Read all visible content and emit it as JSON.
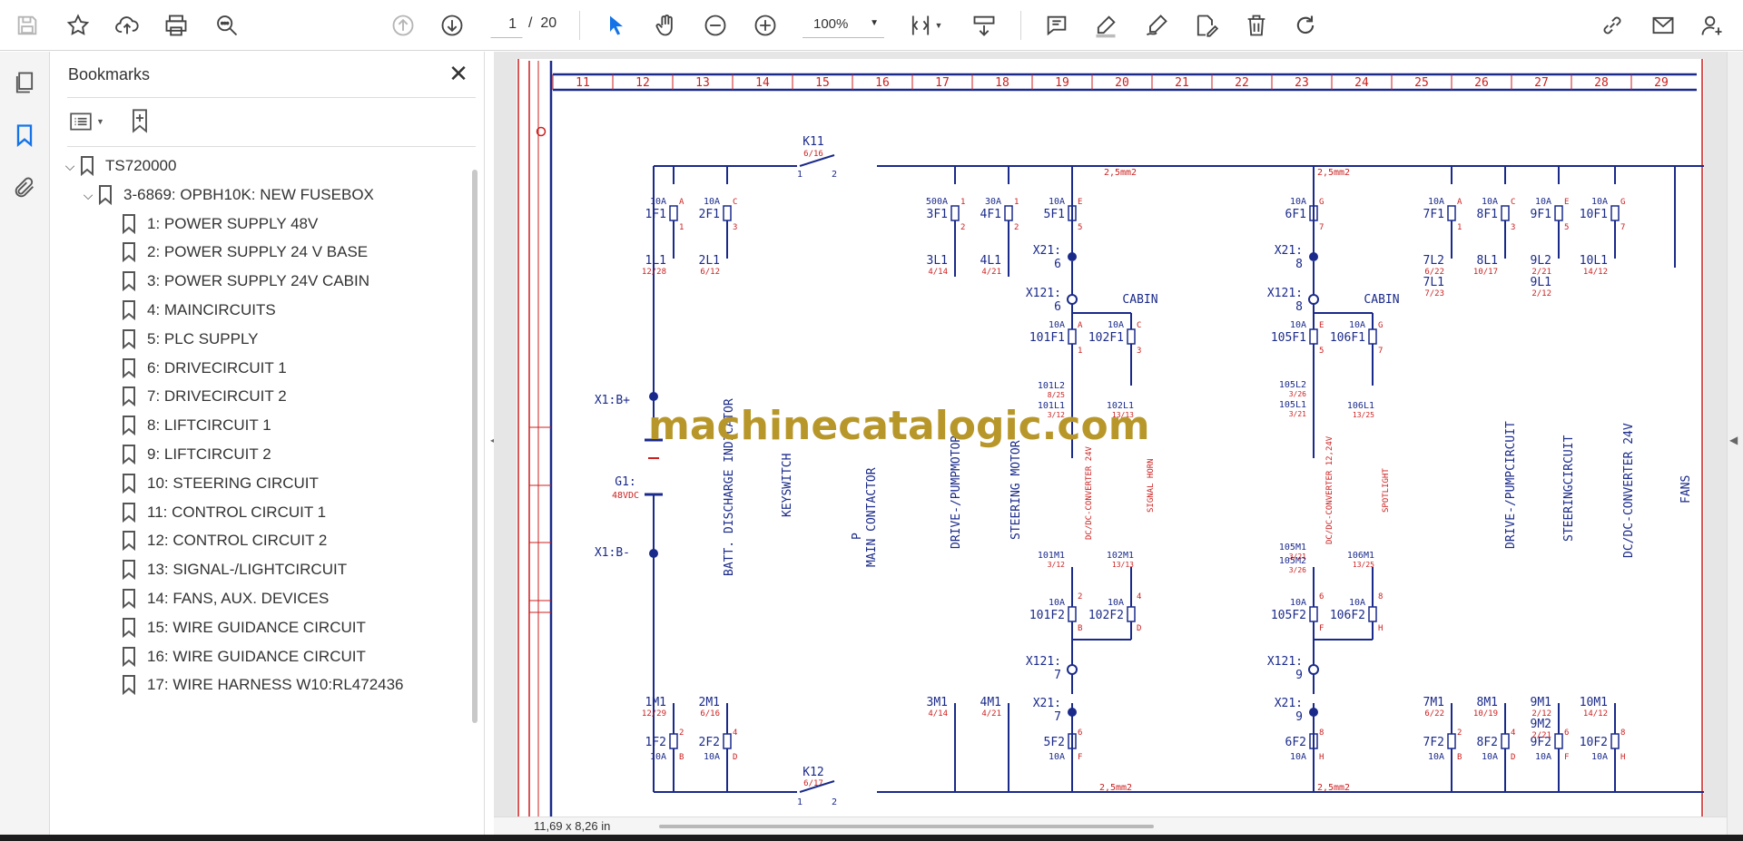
{
  "toolbar": {
    "page_current": "1",
    "page_separator": "/",
    "page_total": "20",
    "zoom": "100%"
  },
  "bookmarks_panel": {
    "title": "Bookmarks",
    "items": [
      {
        "label": "TS720000"
      },
      {
        "label": "3-6869: OPBH10K: NEW FUSEBOX"
      },
      {
        "label": "1: POWER SUPPLY 48V"
      },
      {
        "label": "2: POWER SUPPLY 24 V BASE"
      },
      {
        "label": "3: POWER SUPPLY 24V CABIN"
      },
      {
        "label": "4: MAINCIRCUITS"
      },
      {
        "label": "5: PLC SUPPLY"
      },
      {
        "label": "6: DRIVECIRCUIT 1"
      },
      {
        "label": "7: DRIVECIRCUIT 2"
      },
      {
        "label": "8: LIFTCIRCUIT 1"
      },
      {
        "label": "9: LIFTCIRCUIT 2"
      },
      {
        "label": "10: STEERING CIRCUIT"
      },
      {
        "label": "11: CONTROL CIRCUIT 1"
      },
      {
        "label": "12: CONTROL CIRCUIT 2"
      },
      {
        "label": "13: SIGNAL-/LIGHTCIRCUIT"
      },
      {
        "label": "14: FANS, AUX. DEVICES"
      },
      {
        "label": "15: WIRE GUIDANCE CIRCUIT"
      },
      {
        "label": "16: WIRE GUIDANCE CIRCUIT"
      },
      {
        "label": "17: WIRE HARNESS W10:RL472436"
      }
    ]
  },
  "status": {
    "page_size": "11,69 x 8,26 in"
  },
  "watermark": "machinecatalogic.com",
  "schematic": {
    "columns": [
      "11",
      "12",
      "13",
      "14",
      "15",
      "16",
      "17",
      "18",
      "19",
      "20",
      "21",
      "22",
      "23",
      "24",
      "25",
      "26",
      "27",
      "28",
      "29"
    ],
    "switch_k11": {
      "name": "K11",
      "ref": "6/16",
      "pin1": "1",
      "pin2": "2"
    },
    "switch_k12": {
      "name": "K12",
      "ref": "6/17",
      "pin1": "1",
      "pin2": "2"
    },
    "wire_size": "2,5mm2",
    "battery": {
      "pos": "X1:B+",
      "neg": "X1:B-",
      "name": "G1:",
      "voltage": "48VDC"
    },
    "top_fuses": [
      {
        "name": "1F1",
        "rating": "10A",
        "letter": "A",
        "pin": "1",
        "load": "1L1",
        "ref": "12/28"
      },
      {
        "name": "2F1",
        "rating": "10A",
        "letter": "C",
        "pin": "3",
        "load": "2L1",
        "ref": "6/12"
      },
      {
        "name": "3F1",
        "rating": "500A",
        "letter": "1",
        "pin": "2",
        "load": "3L1",
        "ref": "4/14"
      },
      {
        "name": "4F1",
        "rating": "30A",
        "letter": "1",
        "pin": "2",
        "load": "4L1",
        "ref": "4/21"
      },
      {
        "name": "5F1",
        "rating": "10A",
        "letter": "E",
        "pin": "5",
        "load": "",
        "ref": ""
      },
      {
        "name": "6F1",
        "rating": "10A",
        "letter": "G",
        "pin": "7",
        "load": "",
        "ref": ""
      },
      {
        "name": "7F1",
        "rating": "10A",
        "letter": "A",
        "pin": "1",
        "load": "7L2",
        "ref": "6/22",
        "load2": "7L1",
        "ref2": "7/23"
      },
      {
        "name": "8F1",
        "rating": "10A",
        "letter": "C",
        "pin": "3",
        "load": "8L1",
        "ref": "10/17"
      },
      {
        "name": "9F1",
        "rating": "10A",
        "letter": "E",
        "pin": "5",
        "load": "9L2",
        "ref": "2/21",
        "load2": "9L1",
        "ref2": "2/12"
      },
      {
        "name": "10F1",
        "rating": "10A",
        "letter": "G",
        "pin": "7",
        "load": "10L1",
        "ref": "14/12"
      }
    ],
    "bottom_fuses": [
      {
        "name": "1F2",
        "rating": "10A",
        "letter": "B",
        "pin": "2",
        "load": "1M1",
        "ref": "12/29"
      },
      {
        "name": "2F2",
        "rating": "10A",
        "letter": "D",
        "pin": "4",
        "load": "2M1",
        "ref": "6/16"
      },
      {
        "name": "5F2",
        "rating": "10A",
        "letter": "F",
        "pin": "6",
        "load": "",
        "ref": ""
      },
      {
        "name": "6F2",
        "rating": "10A",
        "letter": "H",
        "pin": "8",
        "load": "",
        "ref": ""
      },
      {
        "name": "7F2",
        "rating": "10A",
        "letter": "B",
        "pin": "2",
        "load": "7M1",
        "ref": "6/22"
      },
      {
        "name": "8F2",
        "rating": "10A",
        "letter": "D",
        "pin": "4",
        "load": "8M1",
        "ref": "10/19"
      },
      {
        "name": "9F2",
        "rating": "10A",
        "letter": "F",
        "pin": "6",
        "load": "9M1",
        "ref": "2/12",
        "load2": "9M2",
        "ref2": "2/21"
      },
      {
        "name": "10F2",
        "rating": "10A",
        "letter": "H",
        "pin": "8",
        "load": "10M1",
        "ref": "14/12"
      }
    ],
    "mid_loads": [
      {
        "name": "3M1",
        "ref": "4/14"
      },
      {
        "name": "4M1",
        "ref": "4/21"
      }
    ],
    "cabin_label": "CABIN",
    "connectors": {
      "x21_6": "X21:",
      "x121": "X121:",
      "n6": "6",
      "n7": "7",
      "n8": "8",
      "n9": "9"
    },
    "cabin_fuses_a": [
      {
        "name": "101F1",
        "rating": "10A",
        "letter": "A",
        "pin": "1"
      },
      {
        "name": "102F1",
        "rating": "10A",
        "letter": "C",
        "pin": "3"
      },
      {
        "name": "101F2",
        "rating": "10A",
        "letter": "B",
        "pin": "2"
      },
      {
        "name": "102F2",
        "rating": "10A",
        "letter": "D",
        "pin": "4"
      }
    ],
    "cabin_fuses_b": [
      {
        "name": "105F1",
        "rating": "10A",
        "letter": "E",
        "pin": "5"
      },
      {
        "name": "106F1",
        "rating": "10A",
        "letter": "G",
        "pin": "7"
      },
      {
        "name": "105F2",
        "rating": "10A",
        "letter": "F",
        "pin": "6"
      },
      {
        "name": "106F2",
        "rating": "10A",
        "letter": "H",
        "pin": "8"
      }
    ],
    "cabin_loads": [
      {
        "name": "101L2",
        "ref": "8/25"
      },
      {
        "name": "101L1",
        "ref": "3/12"
      },
      {
        "name": "102L1",
        "ref": "13/13"
      },
      {
        "name": "105L2",
        "ref": "3/26"
      },
      {
        "name": "105L1",
        "ref": "3/21"
      },
      {
        "name": "106L1",
        "ref": "13/25"
      },
      {
        "name": "101M1",
        "ref": "3/12"
      },
      {
        "name": "102M1",
        "ref": "13/13"
      },
      {
        "name": "105M1",
        "ref": "3/21"
      },
      {
        "name": "105M2",
        "ref": "3/26"
      },
      {
        "name": "106M1",
        "ref": "13/25"
      }
    ],
    "vertical_labels_blue": [
      "BATT. DISCHARGE INDICATOR",
      "KEYSWITCH",
      "MAIN CONTACTOR",
      "P",
      "DRIVE-/PUMPMOTOR",
      "STEERING MOTOR",
      "DRIVE-/PUMPCIRCUIT",
      "STEERINGCIRCUIT",
      "DC/DC-CONVERTER 24V",
      "FANS"
    ],
    "vertical_labels_red": [
      "DC/DC-CONVERTER 24V",
      "SIGNAL HORN",
      "DC/DC-CONVERTER 12,24V",
      "SPOTLIGHT"
    ]
  }
}
